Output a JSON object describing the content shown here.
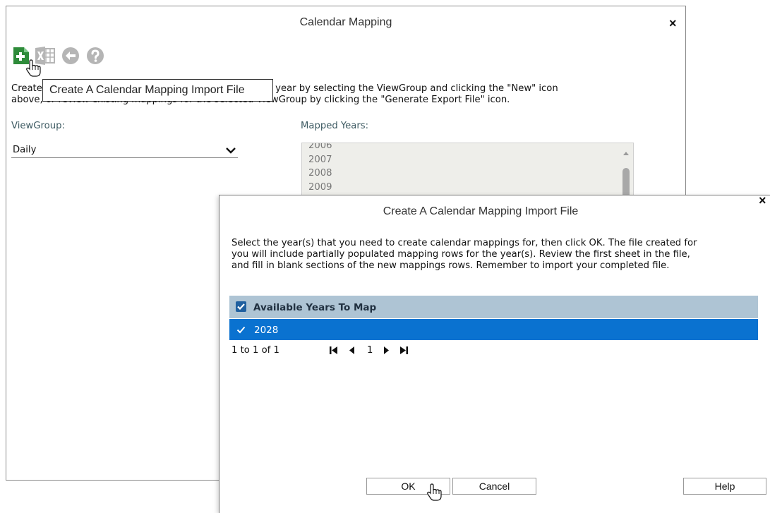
{
  "main_dialog": {
    "title": "Calendar Mapping",
    "close_label": "×",
    "toolbar": [
      {
        "name": "new-mapping-icon",
        "color": "#2e8b3a"
      },
      {
        "name": "excel-export-icon",
        "color": "#b5b5b5"
      },
      {
        "name": "back-icon",
        "color": "#b5b5b5"
      },
      {
        "name": "help-icon",
        "color": "#b5b5b5"
      }
    ],
    "tooltip": "Create A Calendar Mapping Import File",
    "description": "Create new mappings for the selected ViewGroup's new year by selecting the ViewGroup and clicking the \"New\" icon\nabove, or review existing mappings for the selected ViewGroup by clicking the \"Generate Export File\" icon.",
    "viewgroup_label": "ViewGroup:",
    "viewgroup_value": "Daily",
    "mapped_years_label": "Mapped Years:",
    "mapped_years": [
      "2006",
      "2007",
      "2008",
      "2009"
    ]
  },
  "import_dialog": {
    "title": "Create A Calendar Mapping Import File",
    "close_label": "×",
    "description": "Select the year(s) that you need to create calendar mappings for, then click OK. The file created for\nyou will include partially populated mapping rows for the year(s). Review the first sheet in the file,\nand fill in blank sections of the new mappings rows. Remember to import your completed file.",
    "grid_header": "Available Years To Map",
    "rows": [
      {
        "label": "2028",
        "selected": true
      }
    ],
    "pager": {
      "count_text": "1 to 1 of 1",
      "page": "1"
    },
    "buttons": {
      "ok": "OK",
      "cancel": "Cancel",
      "help": "Help"
    }
  },
  "colors": {
    "accent": "#0a72d0",
    "header": "#aec4d4",
    "new_icon": "#2e8b3a"
  }
}
